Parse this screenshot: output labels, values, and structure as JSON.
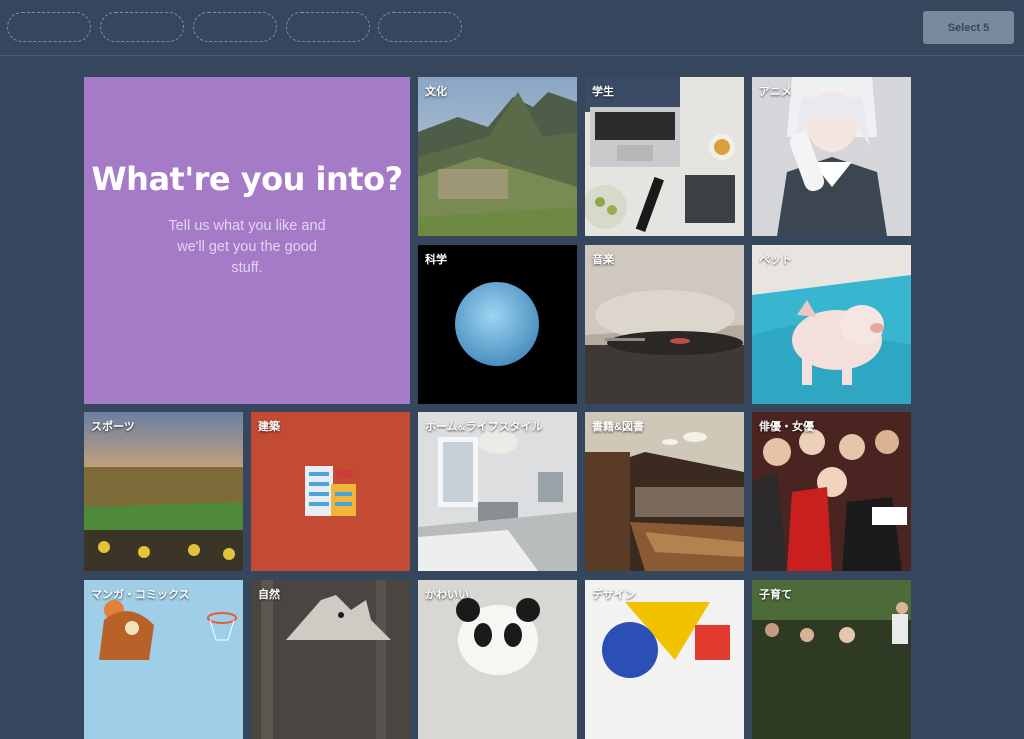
{
  "header": {
    "select_label": "Select 5"
  },
  "hero": {
    "title": "What're you into?",
    "subtitle": "Tell us what you like and we'll get you the good stuff."
  },
  "tiles": [
    {
      "label": "文化",
      "image": "machu-picchu mountain ruins"
    },
    {
      "label": "学生",
      "image": "laptop desk with tea and notebook"
    },
    {
      "label": "アニメ",
      "image": "anime character with white hair"
    },
    {
      "label": "科学",
      "image": "blue planet on black background"
    },
    {
      "label": "音楽",
      "image": "record player turntable"
    },
    {
      "label": "ペット",
      "image": "small pig on blue blanket"
    },
    {
      "label": "スポーツ",
      "image": "football stadium crowd"
    },
    {
      "label": "建築",
      "image": "building icon on orange"
    },
    {
      "label": "ホーム&ライフスタイル",
      "image": "bright white room interior"
    },
    {
      "label": "書籍&図書",
      "image": "library reading room"
    },
    {
      "label": "俳優・女優",
      "image": "celebrity group selfie"
    },
    {
      "label": "マンガ・コミックス",
      "image": "cartoon basketball character"
    },
    {
      "label": "自然",
      "image": "wolf in forest"
    },
    {
      "label": "かわいい",
      "image": "panda"
    },
    {
      "label": "デザイン",
      "image": "colorful geometric shapes"
    },
    {
      "label": "子育て",
      "image": "parent with child outdoors"
    }
  ]
}
